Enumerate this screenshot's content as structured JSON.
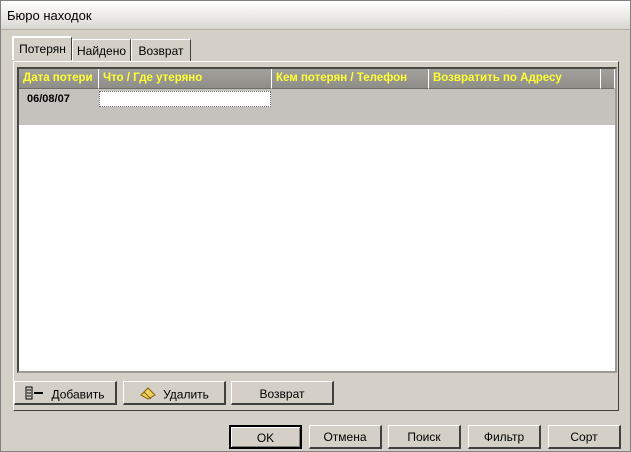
{
  "window": {
    "title": "Бюро находок"
  },
  "tabs": [
    {
      "label": "Потерян",
      "active": true
    },
    {
      "label": "Найдено",
      "active": false
    },
    {
      "label": "Возврат",
      "active": false
    }
  ],
  "grid": {
    "columns": [
      "Дата потери",
      "Что / Где утеряно",
      "Кем потерян / Телефон",
      "Возвратить по Адресу"
    ],
    "rows": [
      {
        "date": "06/08/07",
        "what": "",
        "who": "",
        "address": ""
      }
    ],
    "header_color": "#ffff33"
  },
  "actions": {
    "add_label": "Добавить",
    "delete_label": "Удалить",
    "return_label": "Возврат"
  },
  "footer": {
    "ok_label": "OK",
    "cancel_label": "Отмена",
    "search_label": "Поиск",
    "filter_label": "Фильтр",
    "sort_label": "Сорт"
  }
}
